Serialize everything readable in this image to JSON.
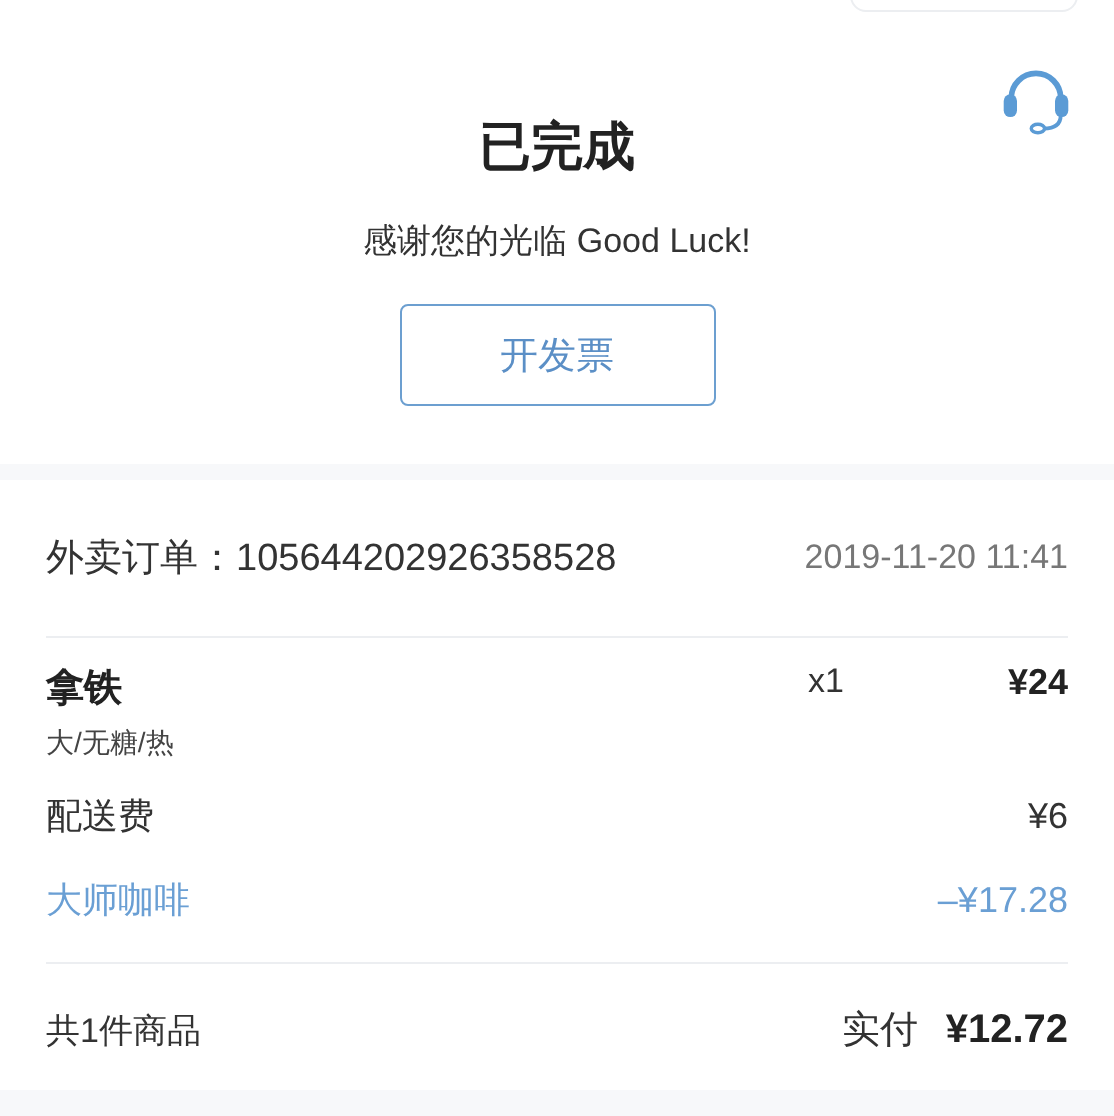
{
  "status": {
    "title": "已完成",
    "message": "感谢您的光临 Good Luck!",
    "invoice_button": "开发票"
  },
  "order": {
    "label": "外卖订单：",
    "number": "105644202926358528",
    "time": "2019-11-20 11:41"
  },
  "lines": [
    {
      "kind": "item",
      "name": "拿铁",
      "options": "大/无糖/热",
      "quantity": "x1",
      "price": "¥24"
    },
    {
      "kind": "fee",
      "name": "配送费",
      "price": "¥6"
    },
    {
      "kind": "discount",
      "name": "大师咖啡",
      "price": "–¥17.28"
    }
  ],
  "summary": {
    "count": "共1件商品",
    "paid_label": "实付",
    "paid": "¥12.72"
  }
}
